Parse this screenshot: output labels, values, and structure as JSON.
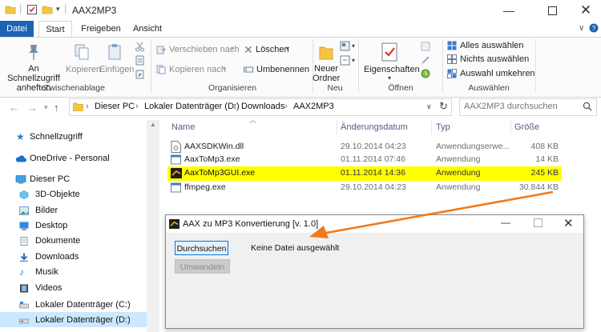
{
  "window": {
    "title": "AAX2MP3"
  },
  "tabs": [
    {
      "label": "Datei"
    },
    {
      "label": "Start"
    },
    {
      "label": "Freigeben"
    },
    {
      "label": "Ansicht"
    }
  ],
  "ribbon": {
    "pin_line1": "An Schnellzugriff",
    "pin_line2": "anheften",
    "copy": "Kopieren",
    "paste": "Einfügen",
    "group_clipboard": "Zwischenablage",
    "move_to": "Verschieben nach",
    "copy_to": "Kopieren nach",
    "delete": "Löschen",
    "rename": "Umbenennen",
    "group_organize": "Organisieren",
    "new_folder_line1": "Neuer",
    "new_folder_line2": "Ordner",
    "group_new": "Neu",
    "properties": "Eigenschaften",
    "group_open": "Öffnen",
    "select_all": "Alles auswählen",
    "select_none": "Nichts auswählen",
    "invert_selection": "Auswahl umkehren",
    "group_select": "Auswählen"
  },
  "address": {
    "crumbs": [
      "Dieser PC",
      "Lokaler Datenträger (D:)",
      "Downloads",
      "AAX2MP3"
    ],
    "search_placeholder": "AAX2MP3 durchsuchen"
  },
  "nav": [
    {
      "label": "Schnellzugriff"
    },
    {
      "label": "OneDrive - Personal"
    },
    {
      "label": "Dieser PC"
    },
    {
      "label": "3D-Objekte"
    },
    {
      "label": "Bilder"
    },
    {
      "label": "Desktop"
    },
    {
      "label": "Dokumente"
    },
    {
      "label": "Downloads"
    },
    {
      "label": "Musik"
    },
    {
      "label": "Videos"
    },
    {
      "label": "Lokaler Datenträger (C:)"
    },
    {
      "label": "Lokaler Datenträger (D:)"
    }
  ],
  "columns": {
    "name": "Name",
    "date": "Änderungsdatum",
    "type": "Typ",
    "size": "Größe"
  },
  "files": [
    {
      "name": "AAXSDKWin.dll",
      "date": "29.10.2014 04:23",
      "type": "Anwendungserwe...",
      "size": "408 KB"
    },
    {
      "name": "AaxToMp3.exe",
      "date": "01.11.2014 07:46",
      "type": "Anwendung",
      "size": "14 KB"
    },
    {
      "name": "AaxToMp3GUI.exe",
      "date": "01.11.2014 14:36",
      "type": "Anwendung",
      "size": "245 KB"
    },
    {
      "name": "ffmpeg.exe",
      "date": "29.10.2014 04:23",
      "type": "Anwendung",
      "size": "30.844 KB"
    }
  ],
  "dialog": {
    "title": "AAX zu MP3 Konvertierung [v. 1.0]",
    "browse": "Durchsuchen",
    "convert": "Umwandeln",
    "status": "Keine Datei ausgewählt"
  },
  "colors": {
    "accent": "#1e62b3",
    "highlight": "#ffff00",
    "arrow": "#f07a1c"
  }
}
